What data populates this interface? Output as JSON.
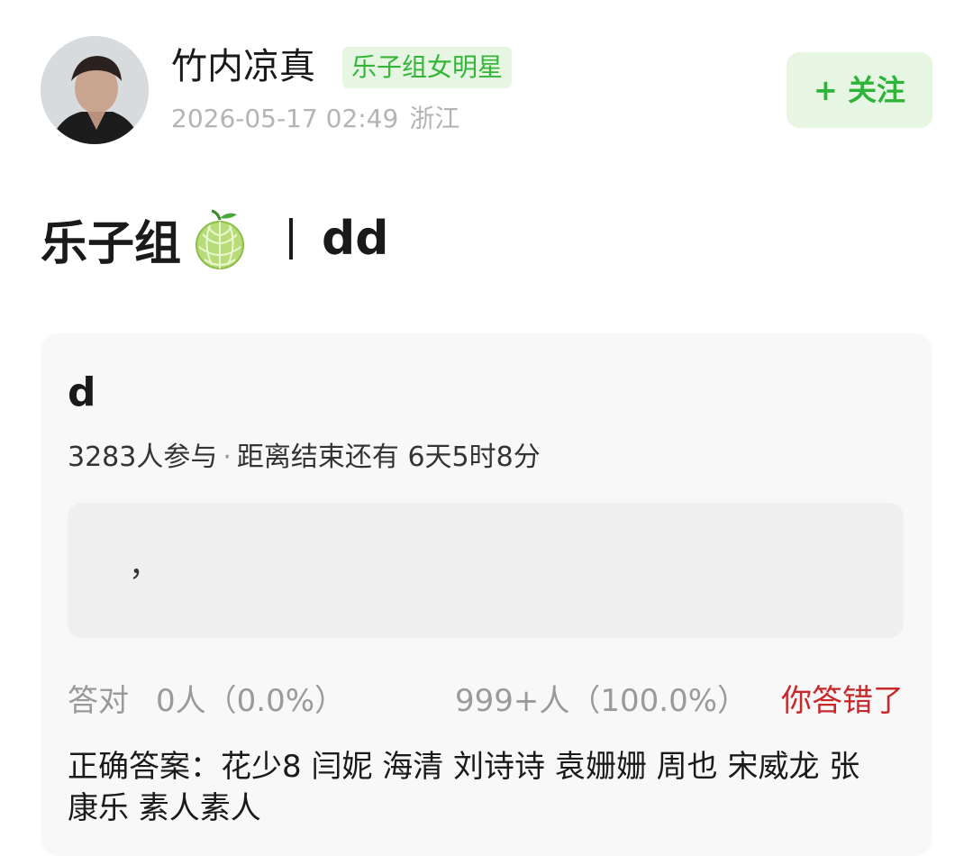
{
  "author": {
    "name": "竹内凉真",
    "badge": "乐子组女明星",
    "timestamp": "2026-05-17 02:49",
    "location": "浙江"
  },
  "follow_button": {
    "label": "+ 关注"
  },
  "post": {
    "title_left": "乐子组",
    "title_emoji_icon": "melon-icon",
    "title_right": "dd"
  },
  "quiz": {
    "title": "d",
    "participants": "3283人参与",
    "separator": "·",
    "time_remaining": "距离结束还有 6天5时8分",
    "answer_input_value": "，",
    "result_label": "答对",
    "correct_count": "0人（0.0%）",
    "wrong_count": "999+人（100.0%）",
    "verdict": "你答错了",
    "correct_answer": "正确答案：花少8 闫妮 海清 刘诗诗 袁姗姗 周也 宋威龙 张康乐 素人素人"
  },
  "colors": {
    "accent_green": "#2fb43a",
    "badge_bg": "#e6f6e2",
    "error_red": "#c8282a"
  }
}
